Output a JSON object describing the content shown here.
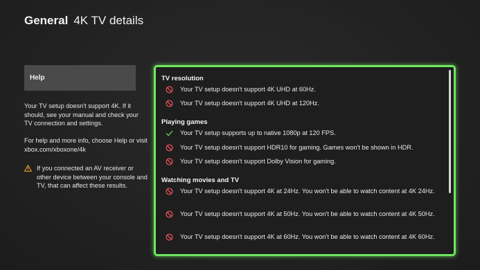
{
  "header": {
    "section": "General",
    "page": "4K TV details"
  },
  "help": {
    "button_label": "Help",
    "paragraph1": "Your TV setup doesn't support 4K. If it should, see your manual and check your TV connection and settings.",
    "paragraph2": "For help and more info, choose Help or visit xbox.com/xboxone/4k",
    "warning": "If you connected an AV receiver or other device between your console and TV, that can affect these results."
  },
  "details": {
    "groups": [
      {
        "title": "TV resolution",
        "items": [
          {
            "status": "not-supported",
            "icon": "prohibited-icon",
            "text": "Your TV setup doesn't support 4K UHD at 60Hz."
          },
          {
            "status": "not-supported",
            "icon": "prohibited-icon",
            "text": "Your TV setup doesn't support 4K UHD at 120Hz."
          }
        ]
      },
      {
        "title": "Playing games",
        "items": [
          {
            "status": "supported",
            "icon": "checkmark-icon",
            "text": "Your TV setup supports up to native 1080p at 120 FPS."
          },
          {
            "status": "not-supported",
            "icon": "prohibited-icon",
            "text": "Your TV setup doesn't support HDR10 for gaming. Games won't be shown in HDR."
          },
          {
            "status": "not-supported",
            "icon": "prohibited-icon",
            "text": "Your TV setup doesn't support Dolby Vision for gaming."
          }
        ]
      },
      {
        "title": "Watching movies and TV",
        "items": [
          {
            "status": "not-supported",
            "icon": "prohibited-icon",
            "text": "Your TV setup doesn't support 4K at 24Hz. You won't be able to watch content at 4K 24Hz."
          },
          {
            "status": "not-supported",
            "icon": "prohibited-icon",
            "text": "Your TV setup doesn't support 4K at 50Hz. You won't be able to watch content at 4K 50Hz."
          },
          {
            "status": "not-supported",
            "icon": "prohibited-icon",
            "text": "Your TV setup doesn't support 4K at 60Hz. You won't be able to watch content at 4K 60Hz."
          }
        ]
      }
    ]
  },
  "colors": {
    "focus_border": "#6ee75e",
    "supported": "#5fd35a",
    "not_supported": "#e8505b",
    "warning": "#f0a030"
  }
}
